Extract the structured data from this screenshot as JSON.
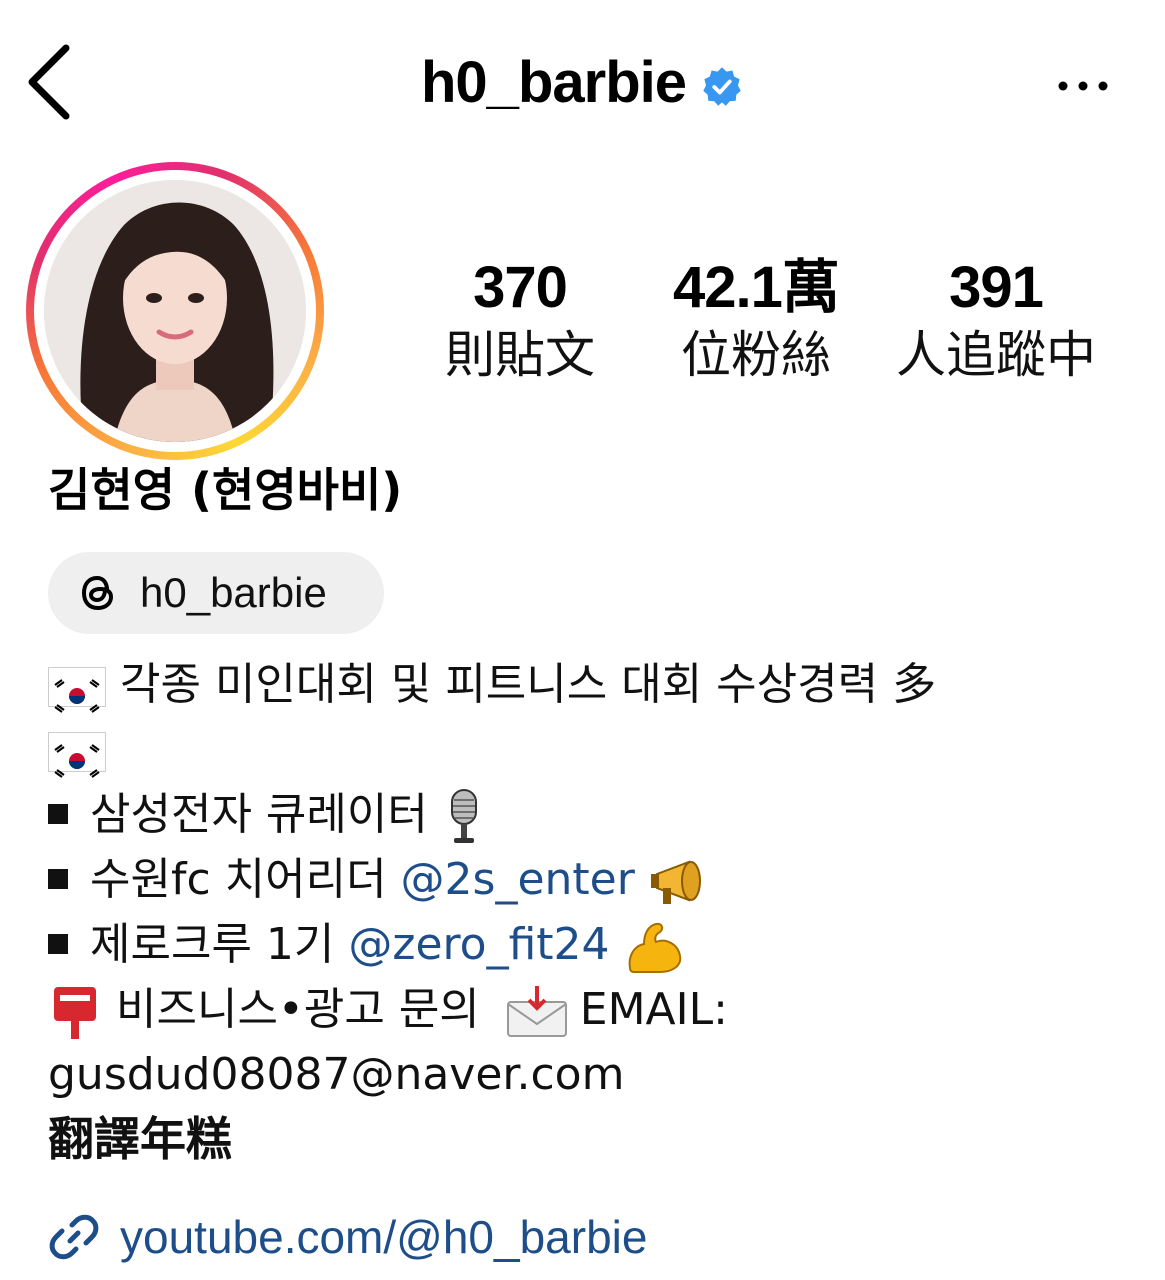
{
  "header": {
    "username": "h0_barbie",
    "verified": true,
    "back_icon": "chevron-left-icon",
    "more_icon": "more-horizontal-icon"
  },
  "profile": {
    "full_name": "김현영 (현영바비)",
    "stats": [
      {
        "value": "370",
        "label": "則貼文"
      },
      {
        "value": "42.1萬",
        "label": "位粉絲"
      },
      {
        "value": "391",
        "label": "人追蹤中"
      }
    ],
    "threads_handle": "h0_barbie"
  },
  "bio": {
    "line1": "각종 미인대회 및 피트니스 대회 수상경력 多",
    "line3": "삼성전자 큐레이터",
    "line4_text": "수원fc 치어리더 ",
    "line4_mention": "@2s_enter",
    "line5_text": "제로크루 1기 ",
    "line5_mention": "@zero_fit24",
    "line6_text": "비즈니스•광고 문의",
    "line6_email_label": "EMAIL:",
    "email": "gusdud08087@naver.com",
    "translate": "翻譯年糕"
  },
  "link": {
    "url": "youtube.com/@h0_barbie"
  },
  "colors": {
    "mention": "#1d4e89",
    "verified": "#3897f0",
    "chip_bg": "#efefef"
  }
}
